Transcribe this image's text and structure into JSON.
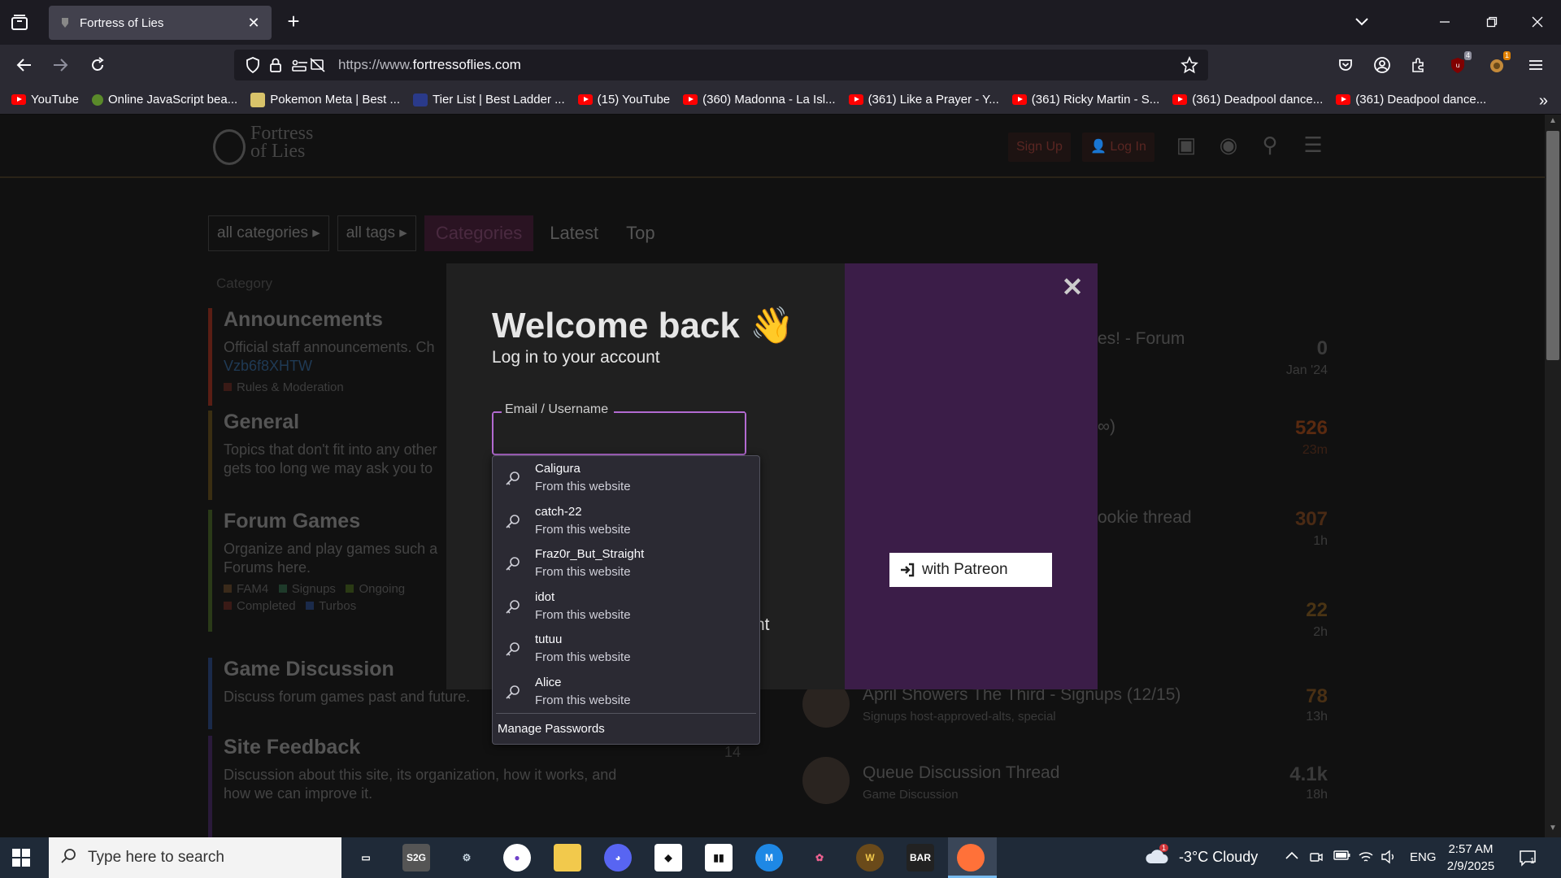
{
  "browser": {
    "tab_title": "Fortress of Lies",
    "url_prefix": "https://www.",
    "url_domain": "fortressoflies.com",
    "bookmarks": [
      {
        "label": "YouTube",
        "icon": "youtube-icon"
      },
      {
        "label": "Online JavaScript bea...",
        "icon": "flower-icon"
      },
      {
        "label": "Pokemon Meta | Best ...",
        "icon": "pokemon-meta-icon"
      },
      {
        "label": "Tier List | Best Ladder ...",
        "icon": "m-logo-icon"
      },
      {
        "label": "(15) YouTube",
        "icon": "youtube-icon"
      },
      {
        "label": "(360) Madonna - La Isl...",
        "icon": "youtube-icon"
      },
      {
        "label": "(361) Like a Prayer - Y...",
        "icon": "youtube-icon"
      },
      {
        "label": "(361) Ricky Martin - S...",
        "icon": "youtube-icon"
      },
      {
        "label": "(361) Deadpool dance...",
        "icon": "youtube-icon"
      },
      {
        "label": "(361) Deadpool dance...",
        "icon": "youtube-icon"
      }
    ],
    "ext_badge_1": "4",
    "ext_badge_2": "1"
  },
  "site": {
    "logo_line1": "Fortress",
    "logo_line2": "of Lies",
    "signup": "Sign Up",
    "login": "Log In",
    "filters": [
      "all categories",
      "all tags"
    ],
    "nav": [
      "Categories",
      "Latest",
      "Top"
    ],
    "category_header": "Category",
    "categories": [
      {
        "title": "Announcements",
        "desc": "Official staff announcements. Ch",
        "desc2": "Vzb6f8XHTW",
        "sub": "Rules & Moderation"
      },
      {
        "title": "General",
        "desc": "Topics that don't fit into any other",
        "desc2": "gets too long we may ask you to",
        "sub": ""
      },
      {
        "title": "Forum Games",
        "desc": "Organize and play games such a",
        "desc2": "Forums here.",
        "sub": ""
      },
      {
        "title": "Game Discussion",
        "desc": "Discuss forum games past and future.",
        "desc2": "",
        "sub": ""
      },
      {
        "title": "Site Feedback",
        "desc": "Discussion about this site, its organization, how it works, and",
        "desc2": "how we can improve it.",
        "sub": ""
      }
    ],
    "forum_game_tags": [
      "FAM4",
      "Signups",
      "Ongoing",
      "Completed",
      "Turbos"
    ],
    "site_feedback_count": "14",
    "topics": [
      {
        "title": "es! - Forum",
        "count": "0",
        "age": "Jan '24",
        "meta": ""
      },
      {
        "title": "∞)",
        "count": "526",
        "age": "23m",
        "meta": ""
      },
      {
        "title": "ookie thread",
        "count": "307",
        "age": "1h",
        "meta": ""
      },
      {
        "title": "",
        "count": "22",
        "age": "2h",
        "meta": ""
      },
      {
        "title": "April Showers The Third - Signups (12/15)",
        "count": "78",
        "age": "13h",
        "meta": "Signups  host-approved-alts, special"
      },
      {
        "title": "Queue Discussion Thread",
        "count": "4.1k",
        "age": "18h",
        "meta": "Game Discussion"
      }
    ]
  },
  "modal": {
    "title": "Welcome back",
    "emoji": "👋",
    "subtitle": "Log in to your account",
    "field_label": "Email / Username",
    "hidden_text": "nt",
    "patreon_label": "with Patreon"
  },
  "autocomplete": {
    "items": [
      {
        "name": "Caligura",
        "source": "From this website"
      },
      {
        "name": "catch-22",
        "source": "From this website"
      },
      {
        "name": "Fraz0r_But_Straight",
        "source": "From this website"
      },
      {
        "name": "idot",
        "source": "From this website"
      },
      {
        "name": "tutuu",
        "source": "From this website"
      },
      {
        "name": "Alice",
        "source": "From this website"
      }
    ],
    "manage": "Manage Passwords"
  },
  "taskbar": {
    "search_placeholder": "Type here to search",
    "weather": "-3°C  Cloudy",
    "weather_badge": "1",
    "lang": "ENG",
    "time": "2:57 AM",
    "date": "2/9/2025",
    "notif_count": "1",
    "apps": [
      "task-view-icon",
      "s2g-icon",
      "steam-icon",
      "github-icon",
      "file-explorer-icon",
      "discord-icon",
      "app-diamond-icon",
      "twitch-icon",
      "mega-icon",
      "osu-icon",
      "wow-icon",
      "bar-icon",
      "firefox-icon"
    ],
    "bar_label": "BAR"
  }
}
